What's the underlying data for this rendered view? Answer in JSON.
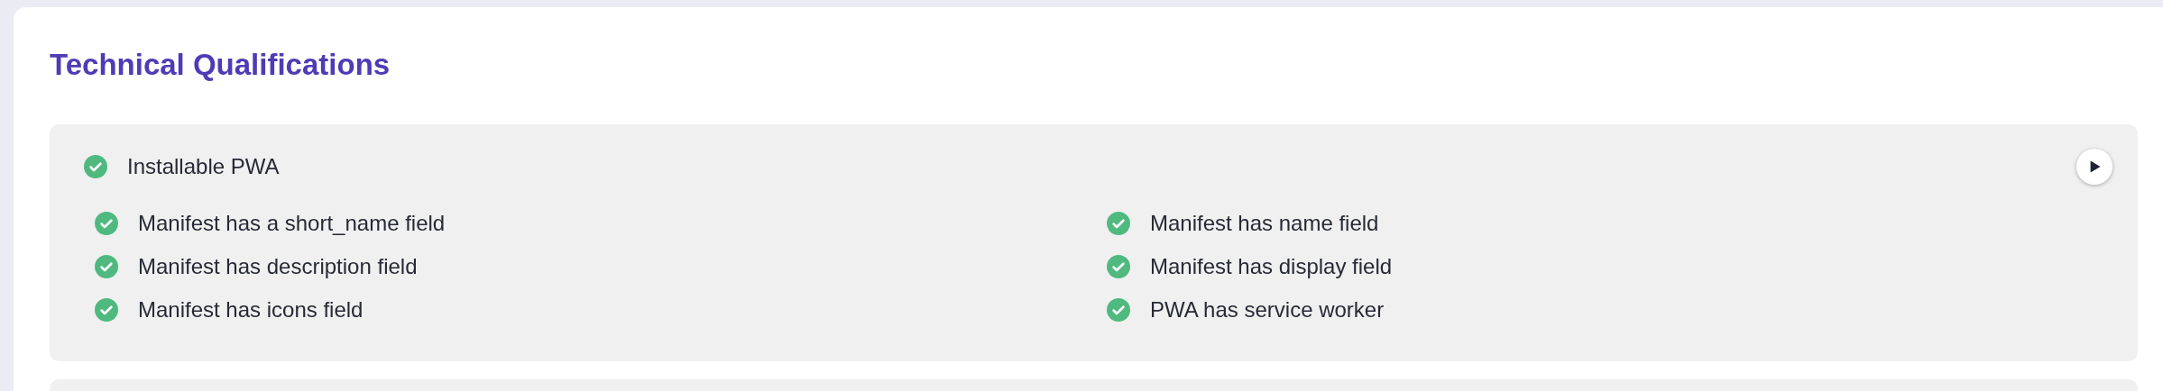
{
  "title": "Technical Qualifications",
  "sections": [
    {
      "label": "Installable PWA",
      "passed": true,
      "items": [
        {
          "label": "Manifest has a short_name field",
          "passed": true
        },
        {
          "label": "Manifest has name field",
          "passed": true
        },
        {
          "label": "Manifest has description field",
          "passed": true
        },
        {
          "label": "Manifest has display field",
          "passed": true
        },
        {
          "label": "Manifest has icons field",
          "passed": true
        },
        {
          "label": "PWA has service worker",
          "passed": true
        }
      ]
    }
  ]
}
